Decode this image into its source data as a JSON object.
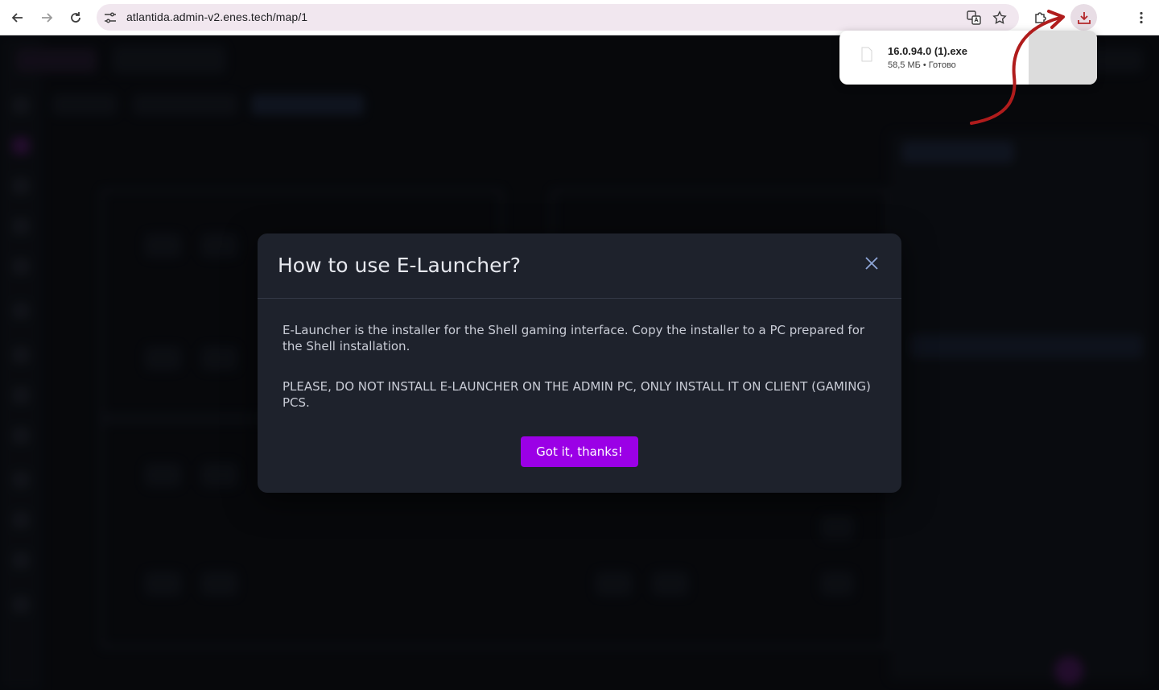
{
  "browser": {
    "url": "atlantida.admin-v2.enes.tech/map/1",
    "icons": {
      "back": "arrow-left-icon",
      "forward": "arrow-right-icon",
      "reload": "reload-icon",
      "site_info": "tune-icon",
      "translate": "translate-icon",
      "bookmark": "star-icon",
      "extensions": "puzzle-icon",
      "downloads": "download-icon",
      "menu": "kebab-menu-icon"
    }
  },
  "downloads_bubble": {
    "file_name": "16.0.94.0 (1).exe",
    "file_status": "58,5 МБ • Готово"
  },
  "modal": {
    "title": "How to use E-Launcher?",
    "paragraph_1": "E-Launcher is the installer for the Shell gaming interface. Copy the installer to a PC prepared for the Shell installation.",
    "paragraph_2": "PLEASE, DO NOT INSTALL E-LAUNCHER ON THE ADMIN PC, ONLY INSTALL IT ON CLIENT (GAMING) PCS.",
    "confirm_label": "Got it, thanks!"
  },
  "colors": {
    "accent": "#9b00e6",
    "modal_bg": "#1e222c",
    "annotation_arrow": "#b01c1c"
  }
}
